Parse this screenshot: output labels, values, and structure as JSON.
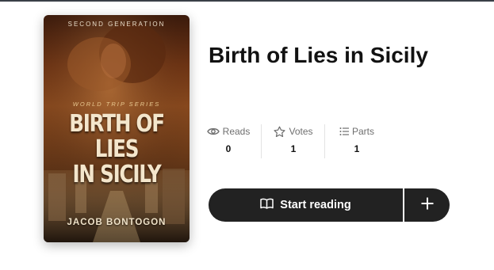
{
  "cover": {
    "series_top": "SECOND GENERATION",
    "series_mid": "WORLD TRIP SERIES",
    "title_line1": "BIRTH OF LIES",
    "title_line2": "IN SICILY",
    "author": "JACOB BONTOGON"
  },
  "book": {
    "title": "Birth of Lies in Sicily"
  },
  "stats": [
    {
      "label": "Reads",
      "value": "0",
      "icon": "eye-icon"
    },
    {
      "label": "Votes",
      "value": "1",
      "icon": "star-icon"
    },
    {
      "label": "Parts",
      "value": "1",
      "icon": "list-icon"
    }
  ],
  "actions": {
    "start_reading_label": "Start reading",
    "start_icon": "open-book-icon",
    "add_icon": "plus-icon"
  },
  "colors": {
    "button_bg": "#222222",
    "text_primary": "#121212",
    "text_muted": "#6f6f6f"
  }
}
